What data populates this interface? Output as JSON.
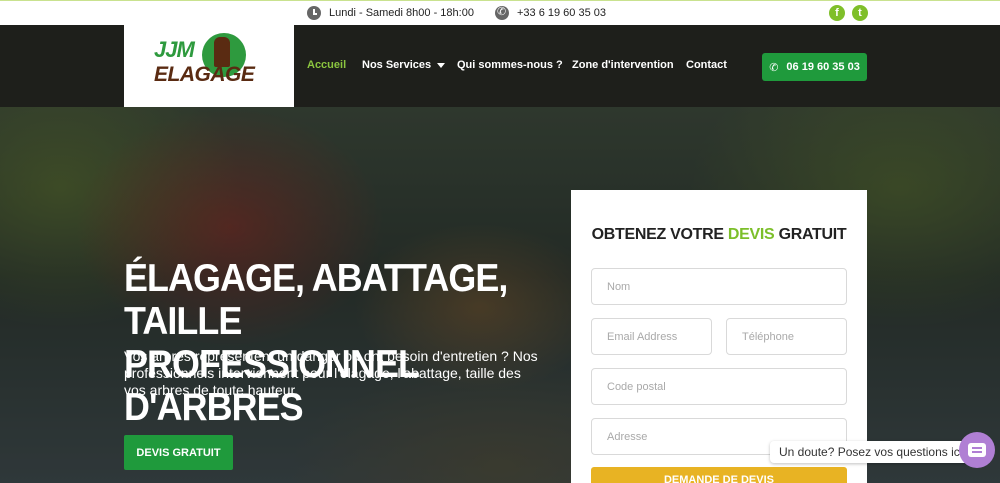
{
  "topbar": {
    "hours": "Lundi - Samedi 8h00 - 18h:00",
    "phone": "+33 6 19 60 35 03",
    "social": [
      {
        "icon": "facebook-icon",
        "glyph": "f"
      },
      {
        "icon": "tumblr-icon",
        "glyph": "t"
      }
    ]
  },
  "logo": {
    "line1": "JJM",
    "line2": "ELAGAGE"
  },
  "nav": {
    "items": [
      "Accueil",
      "Nos Services",
      "Qui sommes-nous ?",
      "Zone d'intervention",
      "Contact"
    ],
    "active_index": 0,
    "phone_button": "06 19 60 35 03"
  },
  "hero": {
    "title_line1": "ÉLAGAGE, ABATTAGE, TAILLE",
    "title_line2": "PROFESSIONNEL D'ARBRES",
    "text": "Vos arbres représentent un danger ou ont besoin d'entretien ? Nos professionnels interviennent pour l'élagage, l'abattage, taille des vos arbres de toute hauteur.",
    "button": "DEVIS GRATUIT"
  },
  "form": {
    "title_before": "OBTENEZ VOTRE",
    "title_highlight": "DEVIS",
    "title_after": "GRATUIT",
    "placeholders": {
      "name": "Nom",
      "email": "Email Address",
      "phone": "Téléphone",
      "postal": "Code postal",
      "address": "Adresse"
    },
    "submit": "DEMANDE DE DEVIS"
  },
  "chat": {
    "prompt": "Un doute? Posez vos questions ici"
  },
  "colors": {
    "accent_green": "#1f9a3c",
    "light_green": "#8bc53f",
    "header_bg": "#1e1f1b",
    "submit_yellow": "#e8b323",
    "chat_purple": "#b07fd4"
  }
}
